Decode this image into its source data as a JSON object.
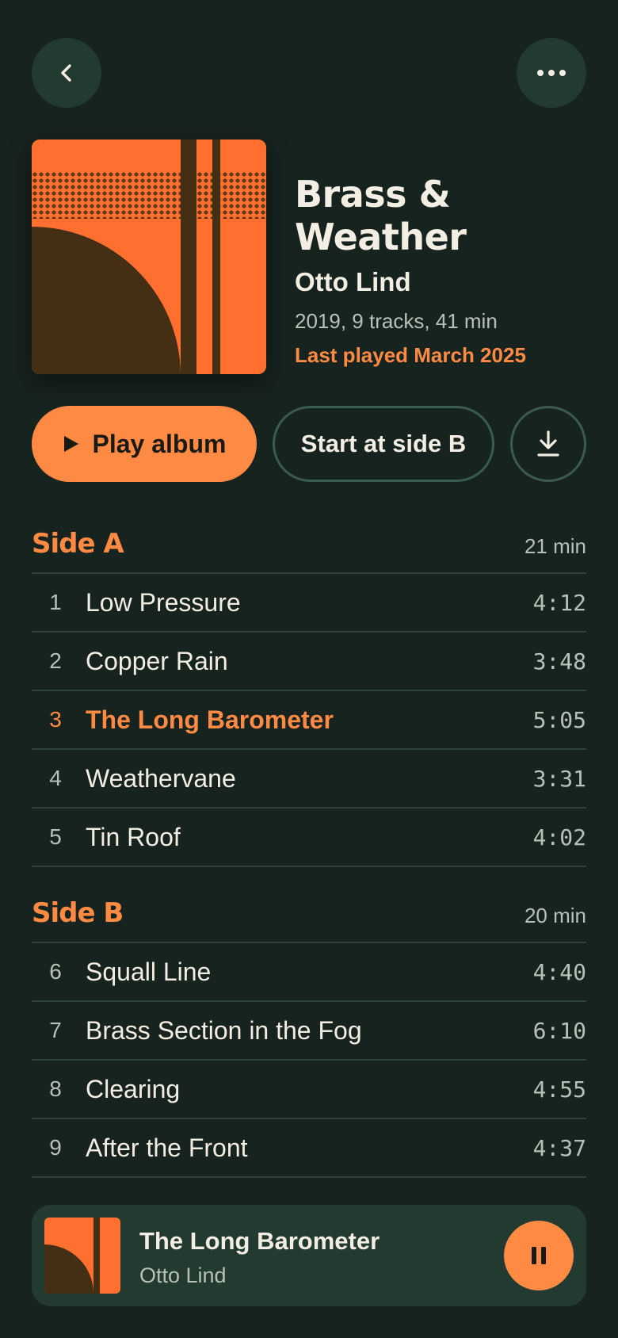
{
  "header": {
    "back_icon": "chevron-left-icon",
    "more_icon": "more-horizontal-icon"
  },
  "album": {
    "title": "Brass & Weather",
    "artist": "Otto Lind",
    "meta": "2019, 9 tracks, 41 min",
    "last_played": "Last played March 2025",
    "cover_colors": {
      "orange": "#ff6f2f",
      "brown": "#452f14"
    }
  },
  "actions": {
    "play_label": "Play album",
    "side_b_label": "Start at side B",
    "download_icon": "download-icon"
  },
  "sides": [
    {
      "title": "Side A",
      "duration": "21 min",
      "tracks": [
        {
          "num": "1",
          "title": "Low Pressure",
          "duration": "4:12"
        },
        {
          "num": "2",
          "title": "Copper Rain",
          "duration": "3:48"
        },
        {
          "num": "3",
          "title": "The Long Barometer",
          "duration": "5:05",
          "active": true
        },
        {
          "num": "4",
          "title": "Weathervane",
          "duration": "3:31"
        },
        {
          "num": "5",
          "title": "Tin Roof",
          "duration": "4:02"
        }
      ]
    },
    {
      "title": "Side B",
      "duration": "20 min",
      "tracks": [
        {
          "num": "6",
          "title": "Squall Line",
          "duration": "4:40"
        },
        {
          "num": "7",
          "title": "Brass Section in the Fog",
          "duration": "6:10"
        },
        {
          "num": "8",
          "title": "Clearing",
          "duration": "4:55"
        },
        {
          "num": "9",
          "title": "After the Front",
          "duration": "4:37"
        }
      ]
    }
  ],
  "now_playing": {
    "title": "The Long Barometer",
    "artist": "Otto Lind",
    "pause_icon": "pause-icon"
  },
  "colors": {
    "background": "#17231f",
    "surface": "#233a31",
    "accent": "#ff8a44",
    "text": "#f3eee3",
    "muted": "#b6c2b8",
    "divider": "#2c4438"
  }
}
